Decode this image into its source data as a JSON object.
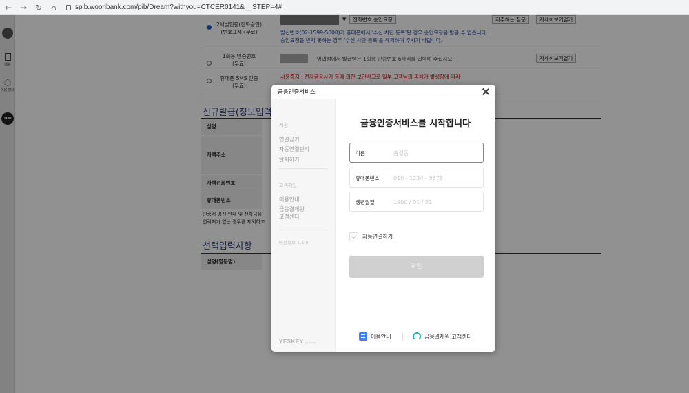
{
  "browser": {
    "url": "spib.wooribank.com/pib/Dream?withyou=CTCER0141&__STEP=4#"
  },
  "left_rail": {
    "menu_label": "메뉴",
    "usage_label": "이용 안내",
    "top_label": "TOP"
  },
  "background_page": {
    "auth_option_1": "2채널인증(전화승인)\n(번호표시)(무료)",
    "phone_approval_button": "전화번호 승인요청",
    "faq_button": "자주하는 질문",
    "detail_button_1": "자세히보기열기",
    "blue_notice": "발신번호(02-1599-5000)가 휴대폰에서 '수신 차단 등록'된 경우 승인요청을 받을 수 없습니다.\n승인요청을 받지 못하는 경우 '수신 차단 등록'을 해제하여 주시기 바랍니다.",
    "auth_option_2": "1회용 인증번호\n(무료)",
    "otp_notice": "영업점에서 발급받은 1회용 인증번호 6자리를 입력해 주십시오.",
    "detail_button_2": "자세히보기열기",
    "auth_option_3": "휴대폰 SMS 인증\n(무료)",
    "red_notice": "사용중지 : 전자금융사기 등에 의한 보안사고로 일부 고객님의 피해가 발생함에 따라",
    "section_new_issue": "신규발급(정보입력)",
    "label_name": "성명",
    "label_home_address": "자택주소",
    "label_home_phone": "자택전화번호",
    "label_mobile": "휴대폰번호",
    "notice_bottom": "인증서 경신 안내 및 전자금융\n연락처가 없는 경우를 제외하고",
    "section_optional": "선택입력사항",
    "label_english_name": "성명(영문명)"
  },
  "modal": {
    "title": "금융인증서비스",
    "heading": "금융인증서비스를 시작합니다",
    "sidebar": {
      "group1_heading": "계정",
      "group1_items": [
        "연결끊기",
        "자동연결관리",
        "탈퇴하기"
      ],
      "group2_heading": "고객지원",
      "group2_items": [
        "이용안내",
        "금융결제원\n고객센터"
      ],
      "version_label": "버전정보 1.5.0",
      "logo_text": "YESKEY",
      "logo_sub": "yeskey"
    },
    "fields": {
      "name_label": "이름",
      "name_placeholder": "홍길동",
      "phone_label": "휴대폰번호",
      "phone_placeholder": "010 - 1234 - 5678",
      "birth_label": "생년월일",
      "birth_placeholder": "1900 / 01 / 31"
    },
    "auto_connect_label": "자동연결하기",
    "confirm_label": "확인",
    "footer_guide": "이용안내",
    "footer_center": "금융결제원 고객센터"
  }
}
